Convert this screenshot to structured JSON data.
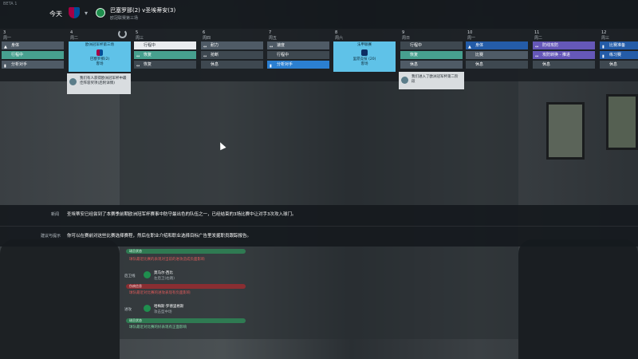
{
  "window": {
    "build": "BETA 1"
  },
  "topbar": {
    "today": "今天",
    "match_title": "巴塞罗那(2) v圣埃蒂安(3)",
    "match_subtitle": "欧冠联赛第三场"
  },
  "calendar": {
    "days": [
      {
        "num": "3",
        "name": "周一",
        "bars": [
          {
            "icon": "▲",
            "label": "身体",
            "style": "b-grey"
          },
          {
            "icon": "",
            "label": "行程中",
            "style": "b-teal"
          },
          {
            "icon": "▮",
            "label": "分析对手",
            "style": "b-grey"
          }
        ]
      },
      {
        "num": "4",
        "name": "周二",
        "match": {
          "top": "欧洲冠军杯第三场",
          "team": "巴塞罗那(2)",
          "venue": "客场"
        }
      },
      {
        "num": "5",
        "name": "周三",
        "bars": [
          {
            "icon": "",
            "label": "行程中",
            "style": "b-white"
          },
          {
            "icon": "↔",
            "label": "恢复",
            "style": "b-teal"
          },
          {
            "icon": "↔",
            "label": "恢复",
            "style": "b-dgrey"
          }
        ]
      },
      {
        "num": "6",
        "name": "周四",
        "bars": [
          {
            "icon": "↔",
            "label": "耐力",
            "style": "b-grey"
          },
          {
            "icon": "↔",
            "label": "抢断",
            "style": "b-dgrey"
          },
          {
            "icon": "",
            "label": "休息",
            "style": "b-dgrey"
          }
        ]
      },
      {
        "num": "7",
        "name": "周五",
        "bars": [
          {
            "icon": "↔",
            "label": "速度",
            "style": "b-grey"
          },
          {
            "icon": "",
            "label": "行程中",
            "style": "b-dgrey"
          },
          {
            "icon": "▮",
            "label": "分析对手",
            "style": "b-blue"
          }
        ]
      },
      {
        "num": "8",
        "name": "周六",
        "match": {
          "top": "法甲联赛",
          "team": "里昂竞技 (20)",
          "venue": "客场"
        }
      },
      {
        "num": "9",
        "name": "周日",
        "bars": [
          {
            "icon": "",
            "label": "行程中",
            "style": "b-dgrey"
          },
          {
            "icon": "",
            "label": "恢复",
            "style": "b-teal"
          },
          {
            "icon": "",
            "label": "休息",
            "style": "b-grey"
          }
        ]
      },
      {
        "num": "10",
        "name": "周一",
        "bars": [
          {
            "icon": "▲",
            "label": "身体",
            "style": "b-navy"
          },
          {
            "icon": "",
            "label": "比赛",
            "style": "b-grey"
          },
          {
            "icon": "",
            "label": "休息",
            "style": "b-dgrey"
          }
        ]
      },
      {
        "num": "11",
        "name": "周二",
        "bars": [
          {
            "icon": "↔",
            "label": "防线攻防",
            "style": "b-purple"
          },
          {
            "icon": "↔",
            "label": "攻防转换 - 推进",
            "style": "b-purple"
          },
          {
            "icon": "",
            "label": "休息",
            "style": "b-dgrey"
          }
        ]
      },
      {
        "num": "12",
        "name": "周三",
        "bars": [
          {
            "icon": "▮",
            "label": "比赛准备",
            "style": "b-navy"
          },
          {
            "icon": "▮",
            "label": "练习赛",
            "style": "b-navy"
          },
          {
            "icon": "",
            "label": "休息",
            "style": "b-dgrey"
          }
        ]
      }
    ],
    "popup_left": "我们有人获得欧洲冠军杯中最佳阵容奖项(后附详情)",
    "popup_right": "我们进入了欧洲冠军杯第二阶段"
  },
  "info": {
    "news_label": "新闻",
    "news_text": "圣埃蒂安已经尝到了本赛季前期欧洲冠军杯赛事中防守最出色的队伍之一，已经结束的3场比赛中让对手3次攻入球门。",
    "advice_label": "建议与提示",
    "advice_text": "你可以在赛前对这些比赛选择赛程，然后在职业介绍和职业选择目标广告里发掘职员跟踪报告。"
  },
  "lower": {
    "pill1": "球员状态",
    "note1": "球队最近比赛的表现对当前的进攻造成负面影响",
    "slot2": "后卫线",
    "player2": "莫马尔·西比",
    "sub2": "左后卫(右路)",
    "pill2": "伤病信息",
    "note2": "球队最近对比赛的进攻表现有负面影响",
    "slot3": "进攻",
    "player3": "哈梅斯·罗德里格斯",
    "sub3": "攻击型中场",
    "pill3": "球员状态",
    "note3": "球队最近对比赛的好表现有正面影响"
  }
}
